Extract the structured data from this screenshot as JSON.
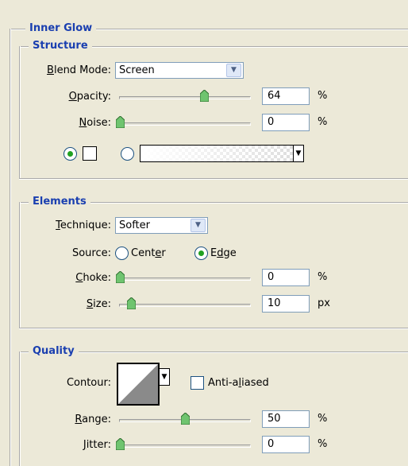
{
  "panel": {
    "title": "Inner Glow"
  },
  "structure": {
    "title": "Structure",
    "blend_mode": {
      "label": "Blend Mode:",
      "value": "Screen"
    },
    "opacity": {
      "label": "Opacity:",
      "value": "64",
      "unit": "%",
      "slider_fraction": 0.64
    },
    "noise": {
      "label": "Noise:",
      "value": "0",
      "unit": "%",
      "slider_fraction": 0
    },
    "color_mode": "solid-color"
  },
  "elements": {
    "title": "Elements",
    "technique": {
      "label": "Technique:",
      "value": "Softer"
    },
    "source": {
      "label": "Source:",
      "center_label": "Center",
      "edge_label": "Edge",
      "selected": "Edge"
    },
    "choke": {
      "label": "Choke:",
      "value": "0",
      "unit": "%",
      "slider_fraction": 0
    },
    "size": {
      "label": "Size:",
      "value": "10",
      "unit": "px",
      "slider_fraction": 0.05
    }
  },
  "quality": {
    "title": "Quality",
    "contour": {
      "label": "Contour:"
    },
    "anti_aliased": {
      "label": "Anti-aliased",
      "checked": false
    },
    "range": {
      "label": "Range:",
      "value": "50",
      "unit": "%",
      "slider_fraction": 0.5
    },
    "jitter": {
      "label": "Jitter:",
      "value": "0",
      "unit": "%",
      "slider_fraction": 0
    }
  },
  "colors": {
    "title_blue": "#1a3fb0",
    "radio_green": "#21a121",
    "background": "#ece9d8"
  }
}
